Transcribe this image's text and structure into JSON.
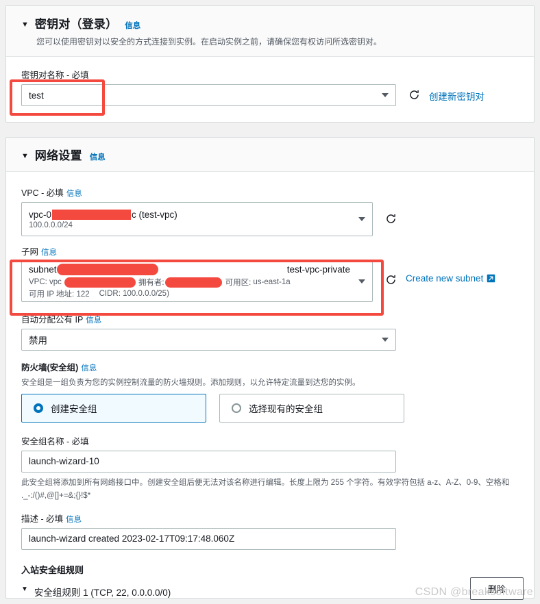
{
  "keypair_section": {
    "title": "密钥对（登录）",
    "info": "信息",
    "description": "您可以使用密钥对以安全的方式连接到实例。在启动实例之前，请确保您有权访问所选密钥对。",
    "field_label": "密钥对名称 - 必填",
    "value": "test",
    "create_link": "创建新密钥对",
    "refresh_icon": "refresh-icon"
  },
  "network_section": {
    "title": "网络设置",
    "info": "信息",
    "vpc": {
      "label": "VPC - 必填",
      "info": "信息",
      "value_prefix": "vpc-0",
      "value_suffix": "c (test-vpc)",
      "cidr": "100.0.0.0/24"
    },
    "subnet": {
      "label": "子网",
      "info": "信息",
      "value_prefix": "subnet",
      "name": "test-vpc-private",
      "vpc_label": "VPC: vpc",
      "owner_label": "拥有者:",
      "az_label": "可用区:",
      "az_value": "us-east-1a",
      "ip_label": "可用 IP 地址: 122",
      "cidr_label": "CIDR: 100.0.0.0/25)",
      "create_link": "Create new subnet",
      "external_icon": "external-link-icon"
    },
    "public_ip": {
      "label": "自动分配公有 IP",
      "info": "信息",
      "value": "禁用"
    },
    "firewall": {
      "label": "防火墙(安全组)",
      "info": "信息",
      "description": "安全组是一组负责为您的实例控制流量的防火墙规则。添加规则，以允许特定流量到达您的实例。",
      "option_create": "创建安全组",
      "option_select": "选择现有的安全组",
      "selected": "create"
    },
    "sg_name": {
      "label": "安全组名称 - 必填",
      "value": "launch-wizard-10",
      "helper": "此安全组将添加到所有网络接口中。创建安全组后便无法对该名称进行编辑。长度上限为 255 个字符。有效字符包括 a-z、A-Z、0-9、空格和 ._-:/()#,@[]+=&;{}!$*"
    },
    "sg_description": {
      "label": "描述 - 必填",
      "info": "信息",
      "value": "launch-wizard created 2023-02-17T09:17:48.060Z"
    },
    "inbound": {
      "heading": "入站安全组规则",
      "rule_text": "安全组规则 1 (TCP, 22, 0.0.0.0/0)",
      "delete_button": "删除"
    }
  },
  "watermark": "CSDN @breaksoftware",
  "colors": {
    "accent_blue": "#0073bb",
    "annotation_red": "#f4493f",
    "redaction_red": "#f4493f",
    "panel_bg": "#ffffff",
    "page_bg": "#f1f1f1"
  }
}
